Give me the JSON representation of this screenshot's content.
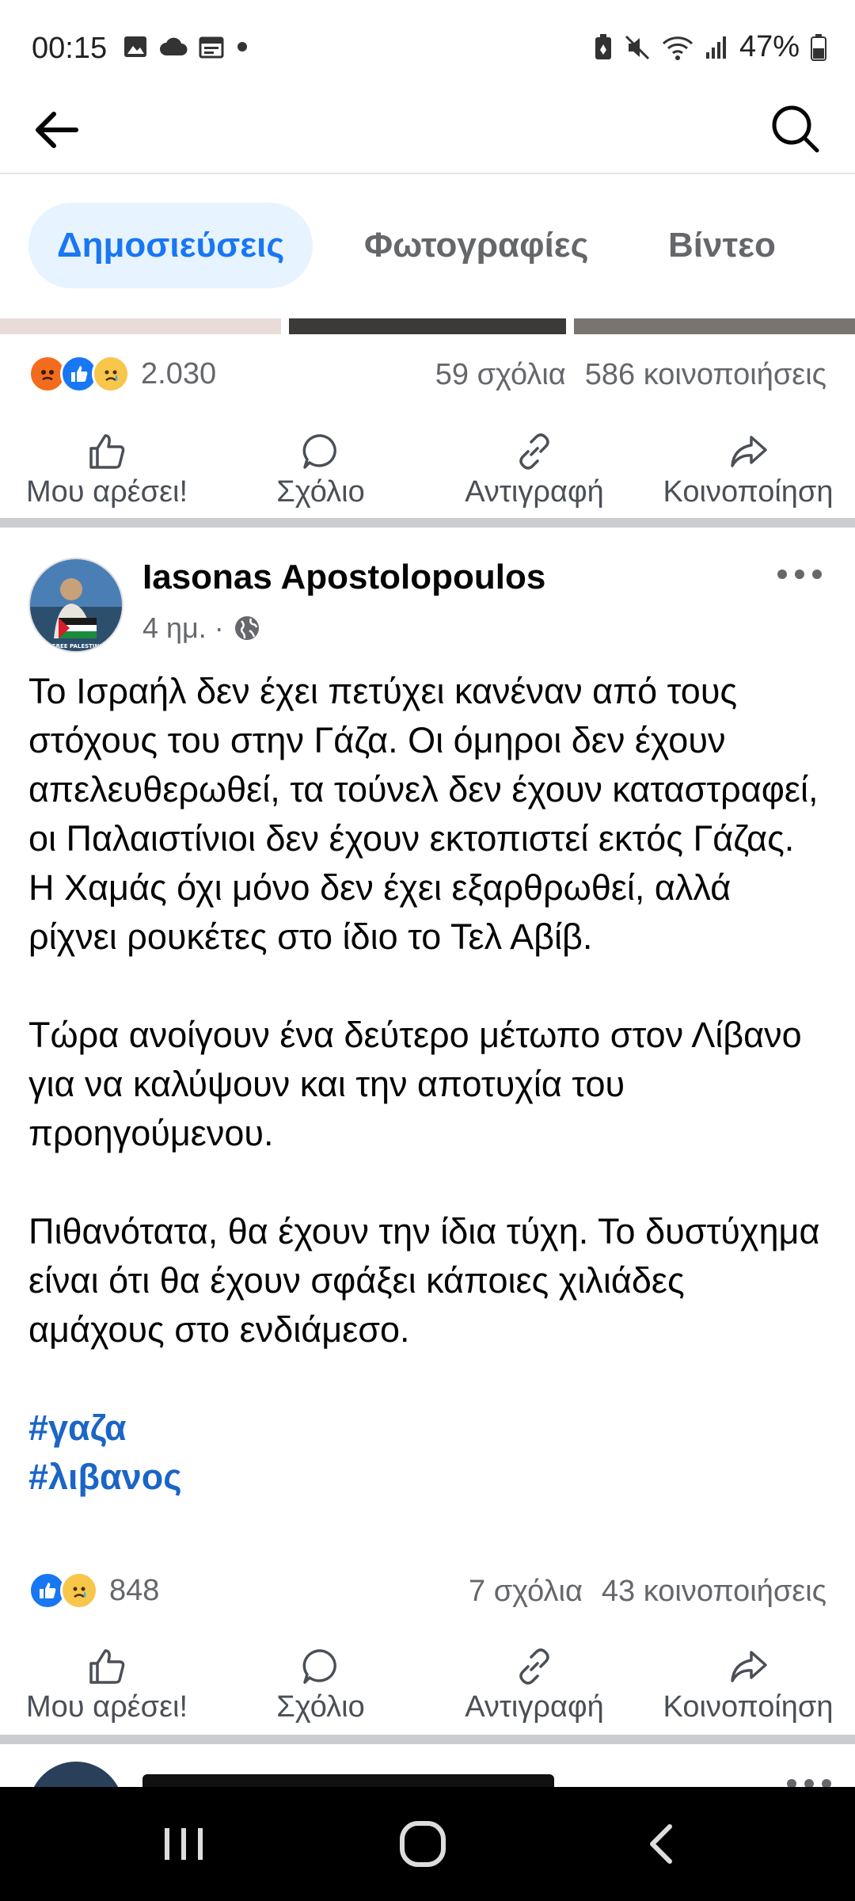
{
  "status_bar": {
    "time": "00:15",
    "battery": "47%",
    "left_icons": [
      "image-icon",
      "cloud-icon",
      "calendar-icon",
      "dot-icon"
    ],
    "right_icons": [
      "battery-saver-icon",
      "mute-icon",
      "wifi-icon",
      "signal-icon",
      "battery-icon"
    ]
  },
  "tabs": [
    {
      "label": "Δημοσιεύσεις",
      "active": true
    },
    {
      "label": "Φωτογραφίες",
      "active": false
    },
    {
      "label": "Βίντεο",
      "active": false
    }
  ],
  "post1": {
    "reaction_count": "2.030",
    "comments": "59 σχόλια",
    "shares": "586 κοινοποιήσεις"
  },
  "actions": {
    "like": "Μου αρέσει!",
    "comment": "Σχόλιο",
    "copy": "Αντιγραφή",
    "share": "Κοινοποίηση"
  },
  "post2": {
    "author": "Iasonas Apostolopoulos",
    "time": "4 ημ. ·",
    "paragraphs": [
      "Το Ισραήλ δεν έχει πετύχει κανέναν από τους στόχους του στην Γάζα. Οι όμηροι δεν έχουν απελευθερωθεί, τα τούνελ δεν έχουν καταστραφεί, οι Παλαιστίνιοι δεν έχουν εκτοπιστεί εκτός Γάζας. Η Χαμάς όχι μόνο δεν έχει εξαρθρωθεί, αλλά ρίχνει ρουκέτες στο ίδιο το Τελ Αβίβ.",
      "Τώρα ανοίγουν ένα δεύτερο μέτωπο στον Λίβανο για να καλύψουν και την αποτυχία του προηγούμενου.",
      "Πιθανότατα, θα έχουν την ίδια τύχη. Το δυστύχημα είναι ότι θα έχουν σφάξει κάποιες χιλιάδες αμάχους στο ενδιάμεσο."
    ],
    "hashtags": [
      "#γαζα",
      "#λιβανος"
    ],
    "reaction_count": "848",
    "comments": "7 σχόλια",
    "shares": "43 κοινοποιήσεις",
    "avatar_caption": "FREE PALESTINE"
  },
  "colors": {
    "accent": "#1877f2",
    "tab_active_bg": "#e7f3ff",
    "hashtag": "#1b65c6",
    "muted": "#65676b"
  }
}
